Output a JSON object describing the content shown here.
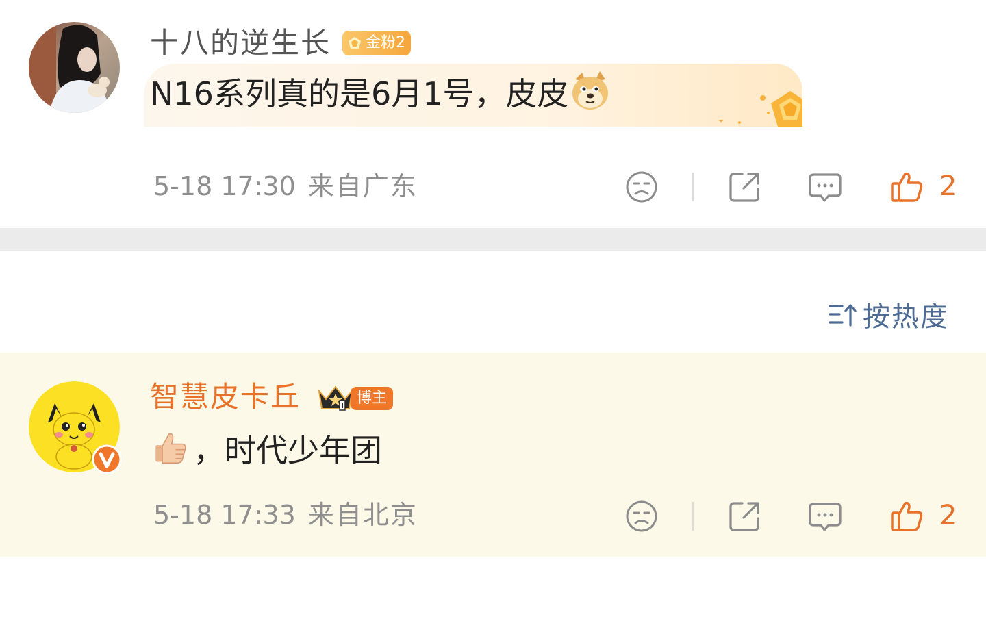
{
  "comments": [
    {
      "username": "十八的逆生长",
      "badge": "金粉2",
      "text": "N16系列真的是6月1号，皮皮",
      "time": "5-18 17:30",
      "location": "来自广东",
      "likes": "2"
    },
    {
      "username": "智慧皮卡丘",
      "badge": "博主",
      "text": "，时代少年团",
      "time": "5-18 17:33",
      "location": "来自北京",
      "likes": "2"
    }
  ],
  "sort": {
    "label": "按热度"
  },
  "colors": {
    "accent": "#e8722a",
    "highlight_bg": "#fdf9e8",
    "divider": "#ebebeb",
    "sort_text": "#4d6b94",
    "meta_text": "#8f8f8f"
  },
  "icons": {
    "dislike": "dislike-face-icon",
    "share": "share-icon",
    "reply": "comment-bubble-icon",
    "like": "thumbs-up-icon",
    "sort": "sort-icon"
  }
}
